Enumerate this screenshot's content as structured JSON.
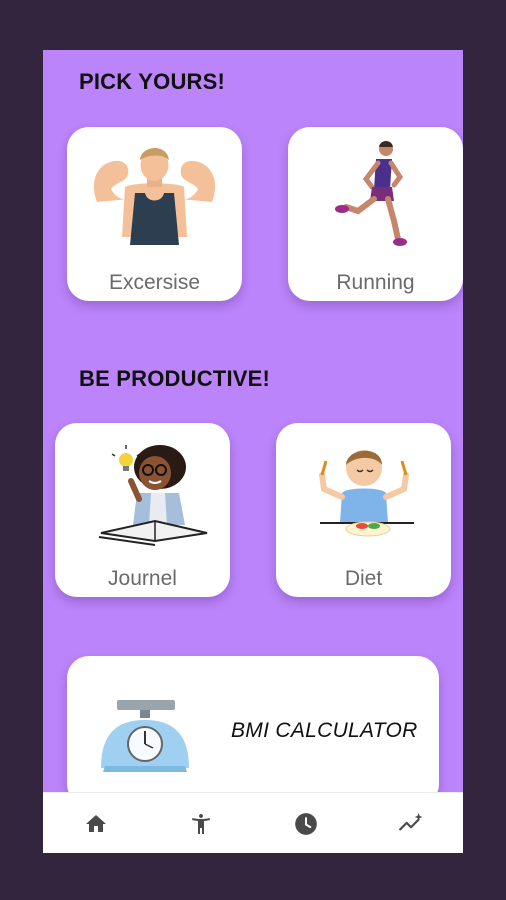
{
  "sections": {
    "pick": {
      "title": "PICK YOURS!"
    },
    "productive": {
      "title": "BE PRODUCTIVE!"
    }
  },
  "cards": {
    "exercise": {
      "label": "Excersise",
      "icon": "muscle-man-illustration"
    },
    "running": {
      "label": "Running",
      "icon": "runner-illustration"
    },
    "journal": {
      "label": "Journel",
      "icon": "girl-writing-illustration"
    },
    "diet": {
      "label": "Diet",
      "icon": "boy-eating-illustration"
    }
  },
  "bmi": {
    "label": "BMI CALCULATOR",
    "icon": "weighing-scale-illustration"
  },
  "nav": {
    "items": [
      {
        "icon": "home-icon"
      },
      {
        "icon": "person-icon"
      },
      {
        "icon": "clock-icon"
      },
      {
        "icon": "trending-icon"
      }
    ]
  },
  "colors": {
    "background": "#33253d",
    "screen": "#bb84fa",
    "card": "#ffffff",
    "nav_icon": "#4a4a4a"
  }
}
